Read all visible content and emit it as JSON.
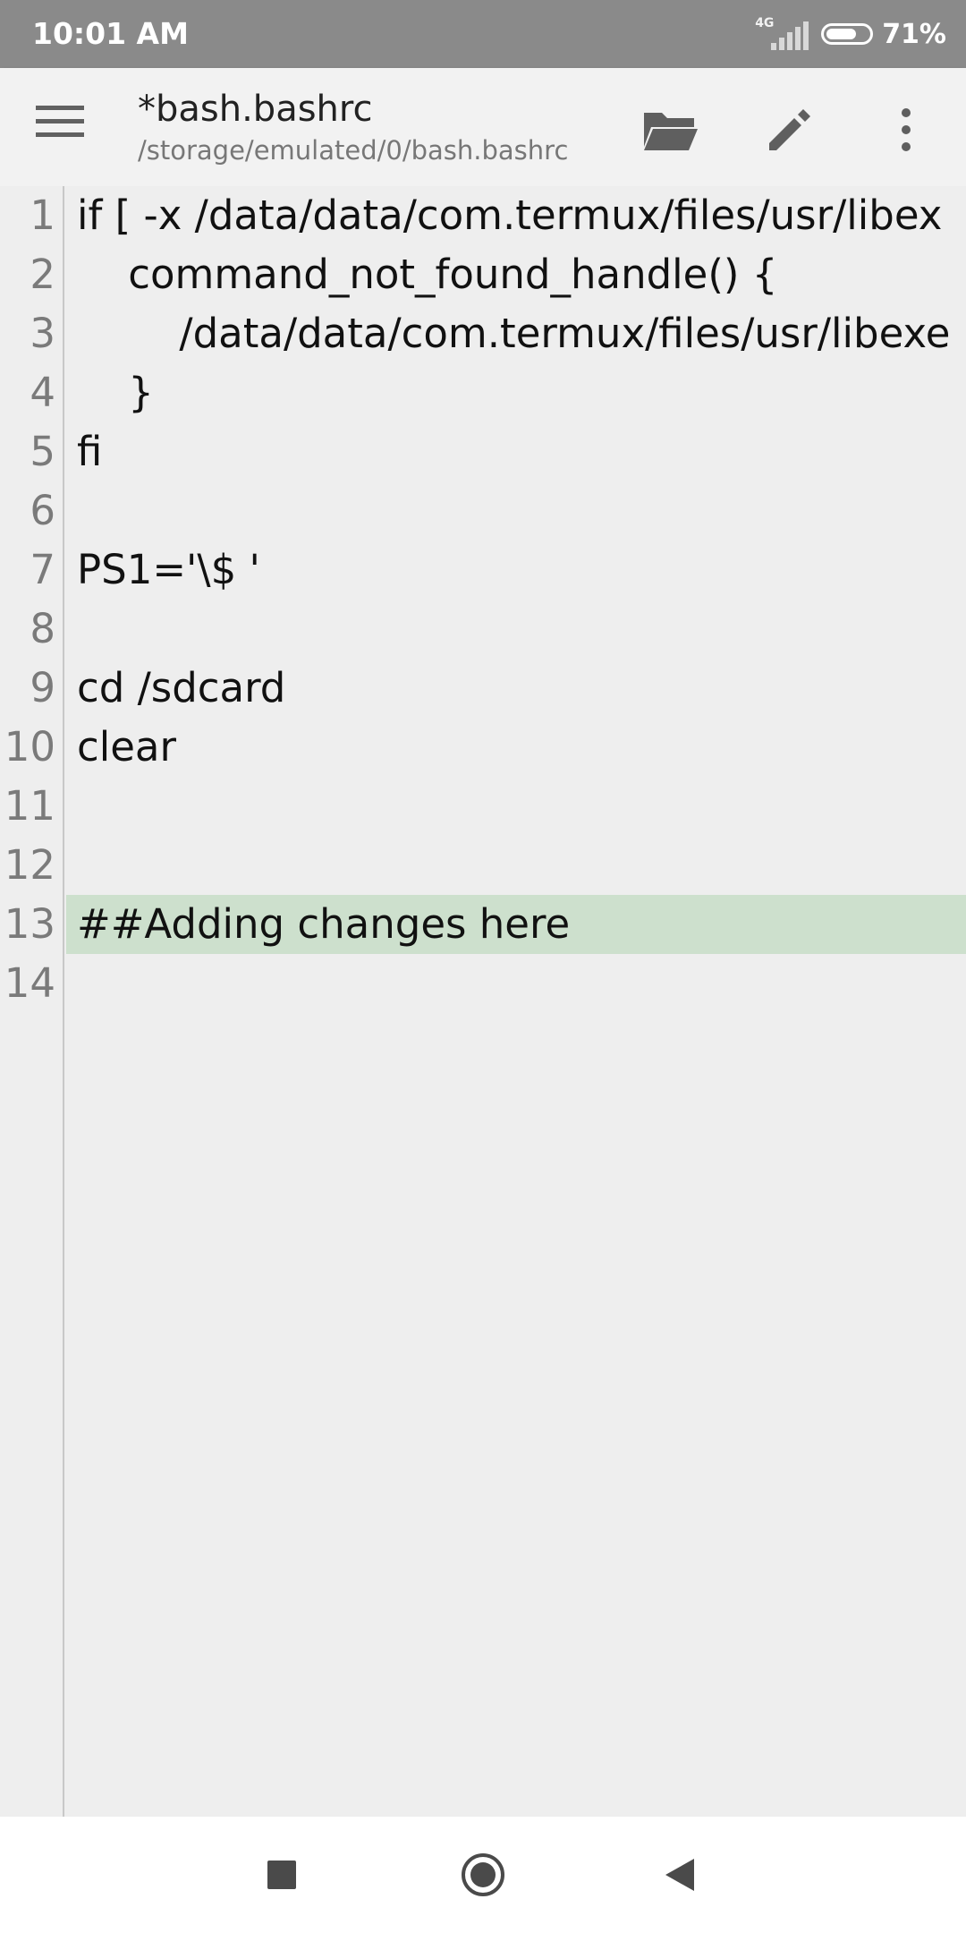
{
  "status_bar": {
    "time": "10:01 AM",
    "network": "4G",
    "battery_percent": "71%",
    "battery_level": 0.71
  },
  "app_bar": {
    "title": "*bash.bashrc",
    "path": "/storage/emulated/0/bash.bashrc",
    "icons": [
      "menu-icon",
      "folder-open-icon",
      "pencil-icon",
      "more-vert-icon"
    ]
  },
  "editor": {
    "current_line": 13,
    "lines": [
      {
        "num": "1",
        "text": "if [ -x /data/data/com.termux/files/usr/libex"
      },
      {
        "num": "2",
        "text": "    command_not_found_handle() {"
      },
      {
        "num": "3",
        "text": "        /data/data/com.termux/files/usr/libexe"
      },
      {
        "num": "4",
        "text": "    }"
      },
      {
        "num": "5",
        "text": "fi"
      },
      {
        "num": "6",
        "text": ""
      },
      {
        "num": "7",
        "text": "PS1='\\$ '"
      },
      {
        "num": "8",
        "text": ""
      },
      {
        "num": "9",
        "text": "cd /sdcard"
      },
      {
        "num": "10",
        "text": "clear"
      },
      {
        "num": "11",
        "text": ""
      },
      {
        "num": "12",
        "text": ""
      },
      {
        "num": "13",
        "text": "##Adding changes here"
      },
      {
        "num": "14",
        "text": ""
      }
    ]
  },
  "nav_bar": {
    "icons": [
      "recent-apps-icon",
      "home-icon",
      "back-icon"
    ]
  },
  "colors": {
    "status_bar": "#8a8a8a",
    "app_bar": "#f2f2f2",
    "editor_bg": "#eeeeee",
    "current_line": "#cde0cd"
  }
}
